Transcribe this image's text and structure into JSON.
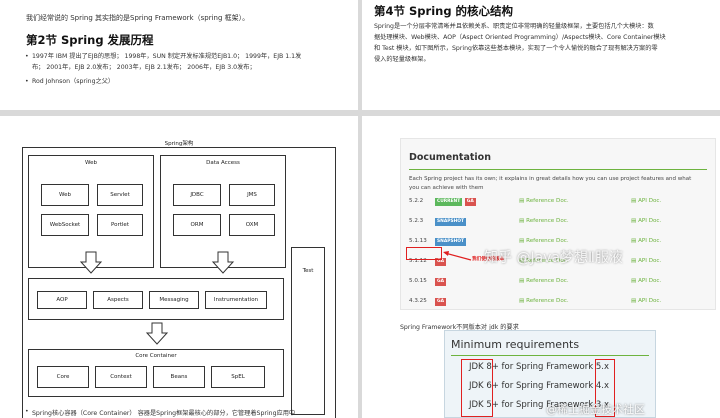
{
  "page1": {
    "intro": "我们经常说的 Spring 其实指的是Spring Framework（spring 框架）。",
    "heading": "第2节 Spring 发展历程",
    "bullet1_line1": "1997年 IBM 提出了EJB的思想； 1998年，SUN 制定开发标准规范EJB1.0； 1999年，EJB 1.1发",
    "bullet1_line2": "布； 2001年，EJB 2.0发布； 2003年，EJB 2.1发布； 2006年，EJB 3.0发布；",
    "bullet2": "Rod Johnson（spring之父）"
  },
  "page2": {
    "heading": "第4节 Spring 的核心结构",
    "para_line1": "Spring是一个分层非常清晰并且依赖关系、职责定位非常明确的轻量级框架，主要包括几个大模块：数",
    "para_line2": "据处理模块、Web模块、AOP（Aspect Oriented Programming）/Aspects模块、Core Container模块",
    "para_line3": "和 Test 模块，如下图所示，Spring依靠这些基本模块，实现了一个令人愉悦的融合了现有解决方案的零",
    "para_line4": "侵入的轻量级框架。"
  },
  "diagram": {
    "title": "Spring架构",
    "web": {
      "title": "Web",
      "items": [
        "Web",
        "Servlet",
        "WebSocket",
        "Portlet"
      ]
    },
    "data_access": {
      "title": "Data Access",
      "items": [
        "JDBC",
        "JMS",
        "ORM",
        "OXM"
      ]
    },
    "middle": [
      "AOP",
      "Aspects",
      "Messaging",
      "Instrumentation"
    ],
    "core": {
      "title": "Core Container",
      "items": [
        "Core",
        "Context",
        "Beans",
        "SpEL"
      ]
    },
    "test": "Test",
    "caption": "Spring核心容器（Core Container） 容器是Spring框架最核心的部分，它管理着Spring应用中"
  },
  "docs": {
    "title": "Documentation",
    "desc_line1": "Each Spring project has its own; it explains in great details how you can use project features and what",
    "desc_line2": "you can achieve with them",
    "ref_label": "Reference Doc.",
    "api_label": "API Doc.",
    "versions": [
      {
        "version": "5.2.2",
        "badges": [
          {
            "text": "CURRENT",
            "kind": "cur"
          },
          {
            "text": "GA",
            "kind": "ga"
          }
        ]
      },
      {
        "version": "5.2.3",
        "badges": [
          {
            "text": "SNAPSHOT",
            "kind": "snap"
          }
        ]
      },
      {
        "version": "5.1.13",
        "badges": [
          {
            "text": "SNAPSHOT",
            "kind": "snap"
          }
        ]
      },
      {
        "version": "5.1.12",
        "badges": [
          {
            "text": "GA",
            "kind": "ga"
          }
        ]
      },
      {
        "version": "5.0.15",
        "badges": [
          {
            "text": "GA",
            "kind": "ga"
          }
        ]
      },
      {
        "version": "4.3.25",
        "badges": [
          {
            "text": "GA",
            "kind": "ga"
          }
        ]
      }
    ],
    "annotation": "我们使用的版本"
  },
  "requirements": {
    "caption": "Spring Framework不同版本对 jdk 的要求",
    "title": "Minimum requirements",
    "items": [
      "JDK 8+ for Spring Framework 5.x",
      "JDK 6+ for Spring Framework 4.x",
      "JDK 5+ for Spring Framework 3.x"
    ]
  },
  "watermarks": [
    "知乎 @Java梦想Ⅱ服液",
    "@稀土掘金技术社区"
  ],
  "colors": {
    "spring_green": "#6db33f",
    "badge_ga": "#d9534f",
    "badge_current": "#5cb85c",
    "badge_snapshot": "#4a90c8",
    "highlight_red": "#e02020"
  }
}
